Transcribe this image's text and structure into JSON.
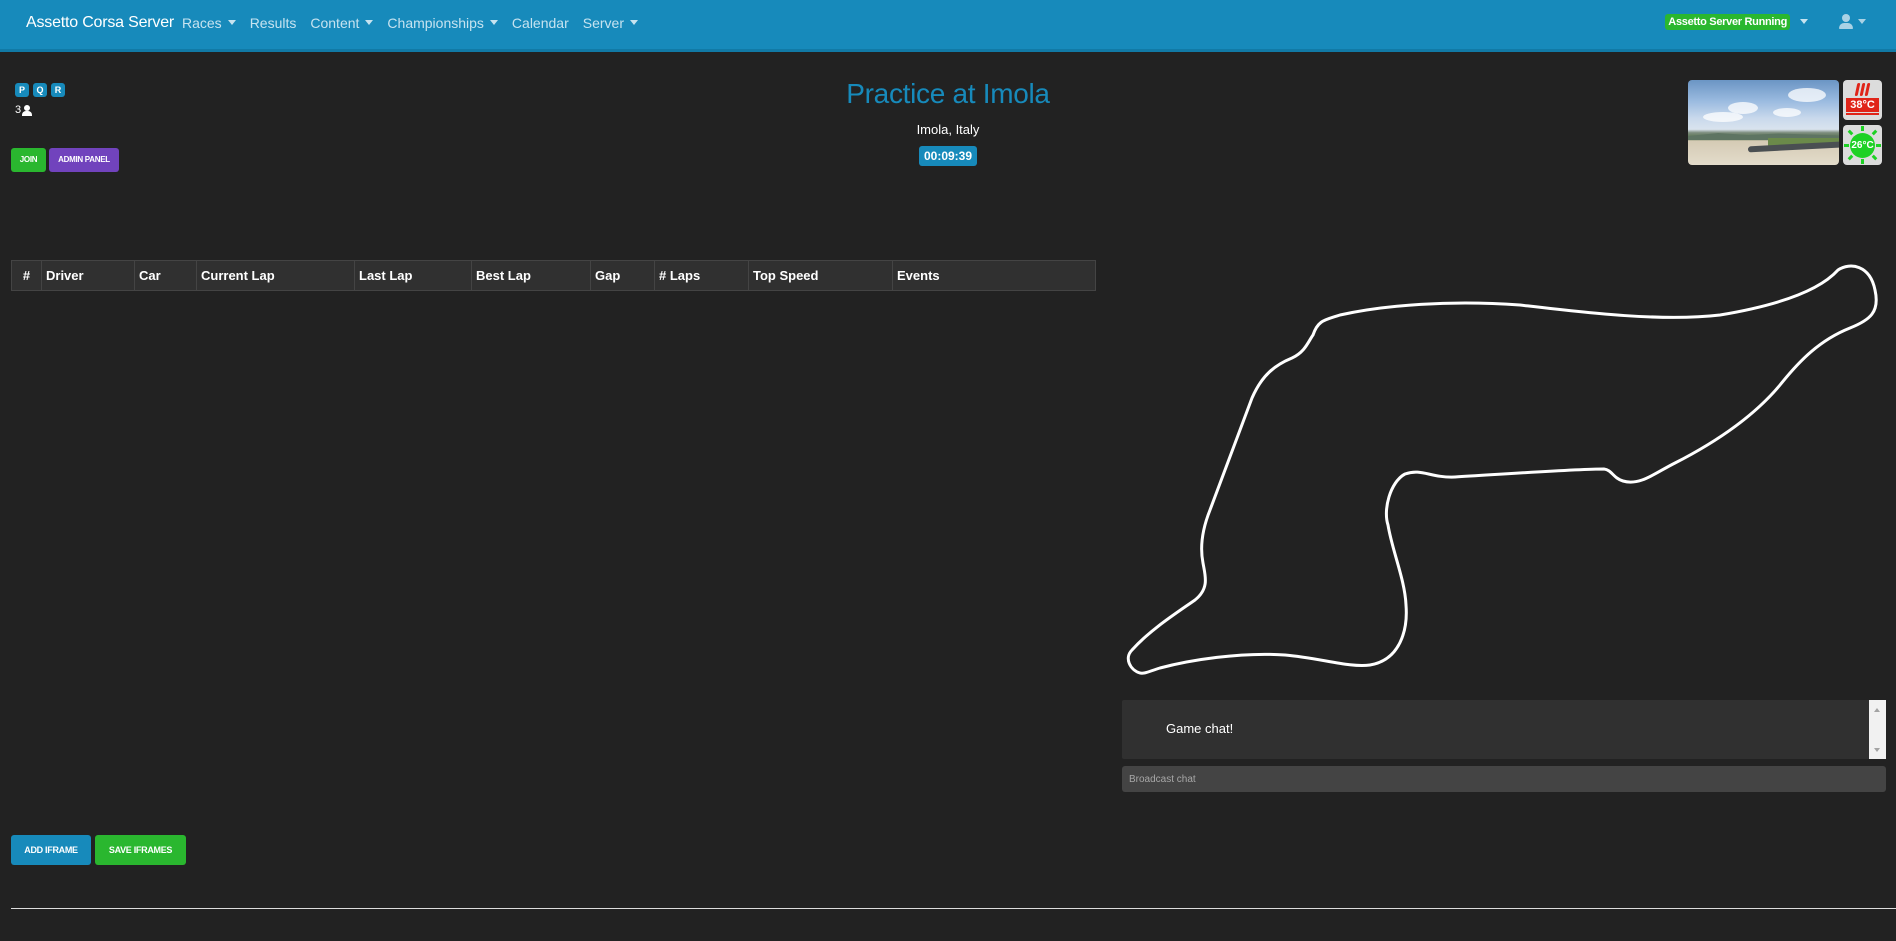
{
  "navbar": {
    "brand": "Assetto Corsa Server",
    "items": [
      {
        "label": "Races",
        "dropdown": true
      },
      {
        "label": "Results",
        "dropdown": false
      },
      {
        "label": "Content",
        "dropdown": true
      },
      {
        "label": "Championships",
        "dropdown": true
      },
      {
        "label": "Calendar",
        "dropdown": false
      },
      {
        "label": "Server",
        "dropdown": true
      }
    ],
    "server_status": "Assetto Server Running",
    "user_icon": "user-icon"
  },
  "session": {
    "types": [
      "P",
      "Q",
      "R"
    ],
    "connected_clients": "3",
    "join_label": "JOIN",
    "admin_label": "ADMIN PANEL",
    "title": "Practice at Imola",
    "location": "Imola, Italy",
    "timer": "00:09:39"
  },
  "weather": {
    "track_temp": "38°C",
    "ambient_temp": "26°C",
    "track_temp_icon": "heat-icon",
    "ambient_temp_icon": "sun-icon"
  },
  "table": {
    "columns": [
      "#",
      "Driver",
      "Car",
      "Current Lap",
      "Last Lap",
      "Best Lap",
      "Gap",
      "# Laps",
      "Top Speed",
      "Events"
    ],
    "rows": []
  },
  "chat": {
    "messages": [
      "Game chat!"
    ],
    "input_placeholder": "Broadcast chat"
  },
  "iframes": {
    "add_label": "ADD IFRAME",
    "save_label": "SAVE IFRAMES"
  },
  "colors": {
    "primary": "#178abb",
    "success": "#2ab72f",
    "admin": "#7143bd",
    "background": "#222222",
    "heat": "#e02418",
    "sun": "#1dd124"
  }
}
